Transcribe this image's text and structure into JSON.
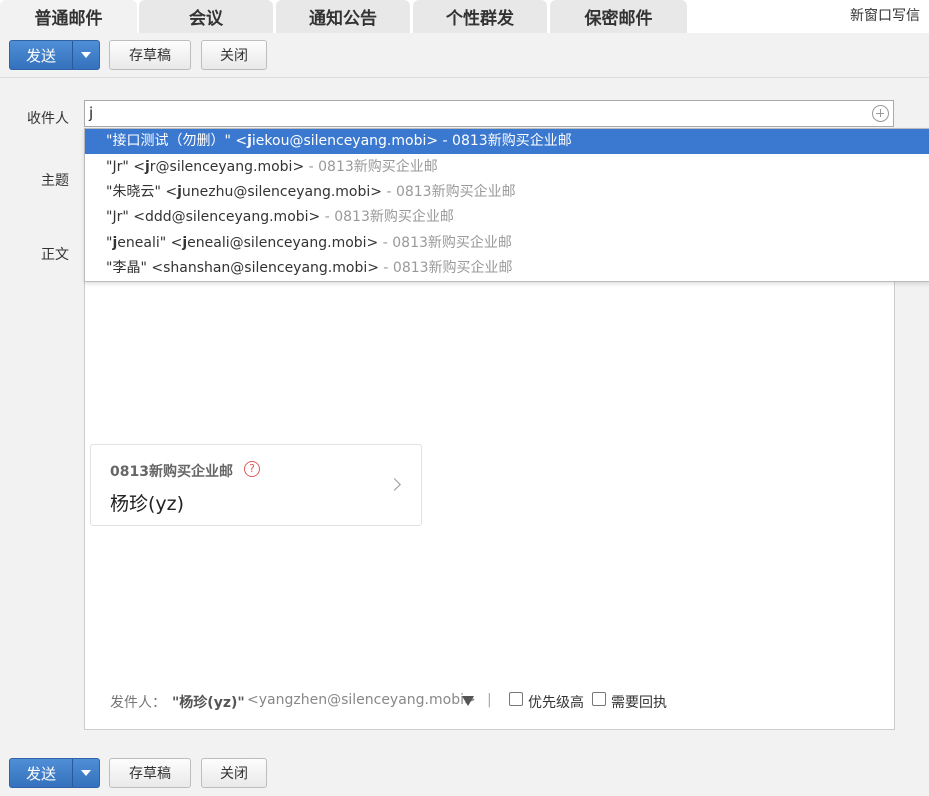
{
  "tabs": [
    {
      "label": "普通邮件",
      "active": true
    },
    {
      "label": "会议",
      "active": false
    },
    {
      "label": "通知公告",
      "active": false
    },
    {
      "label": "个性群发",
      "active": false
    },
    {
      "label": "保密邮件",
      "active": false
    }
  ],
  "new_window_link": "新窗口写信",
  "toolbar": {
    "send_label": "发送",
    "draft_label": "存草稿",
    "close_label": "关闭"
  },
  "form": {
    "to_label": "收件人",
    "to_value": "j",
    "subject_label": "主题",
    "body_label": "正文"
  },
  "suggestions": [
    {
      "name": "\"接口测试（勿删）\"",
      "email_pre": " <",
      "email_bold": "j",
      "email_post": "iekou@silenceyang.mobi>",
      "company": " - 0813新购买企业邮"
    },
    {
      "name": "\"Jr\"",
      "email_pre": " <",
      "email_bold": "j",
      "email_post": "r@silenceyang.mobi>",
      "company": " - 0813新购买企业邮"
    },
    {
      "name": "\"朱晓云\"",
      "email_pre": " <",
      "email_bold": "j",
      "email_post": "unezhu@silenceyang.mobi>",
      "company": " - 0813新购买企业邮"
    },
    {
      "name": "\"Jr\"",
      "email_pre": " <ddd@silenceyang.mobi>",
      "email_bold": "",
      "email_post": "",
      "company": " - 0813新购买企业邮"
    },
    {
      "name": "\"",
      "name_bold": "j",
      "name_post": "eneali\"",
      "email_pre": " <",
      "email_bold": "j",
      "email_post": "eneali@silenceyang.mobi>",
      "company": " - 0813新购买企业邮"
    },
    {
      "name": "\"李晶\"",
      "email_pre": " <shanshan@silenceyang.mobi>",
      "email_bold": "",
      "email_post": "",
      "company": " - 0813新购买企业邮"
    }
  ],
  "signature": {
    "company": "0813新购买企业邮",
    "name": "杨珍(yz)"
  },
  "sender": {
    "label": "发件人：",
    "name": "\"杨珍(yz)\"",
    "email": "<yangzhen@silenceyang.mobi>",
    "separator": "|",
    "priority_label": "优先级高",
    "receipt_label": "需要回执"
  }
}
